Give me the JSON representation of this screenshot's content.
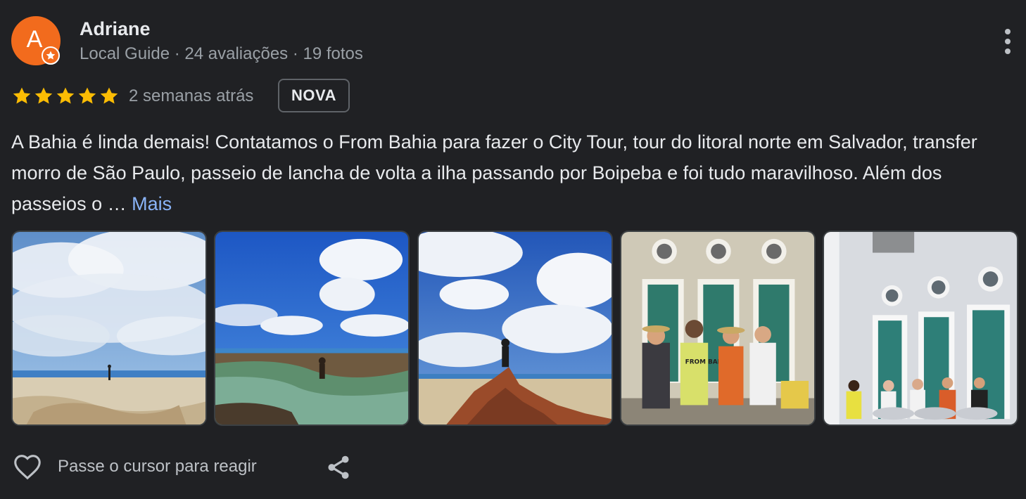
{
  "author": {
    "name": "Adriane",
    "initial": "A",
    "meta": "Local Guide · 24 avaliações · 19 fotos"
  },
  "rating": {
    "stars": 5,
    "time": "2 semanas atrás",
    "badge": "NOVA"
  },
  "review": {
    "text": "A Bahia é linda demais! Contatamos o From Bahia para fazer o City Tour, tour do litoral norte em Salvador, transfer morro de São Paulo, passeio de lancha de volta a ilha passando por Boipeba e foi tudo maravilhoso. Além dos passeios o … ",
    "more_label": "Mais"
  },
  "footer": {
    "react_label": "Passe o cursor para reagir"
  },
  "photos": {
    "count": 5,
    "photo4_shirt_text": "FROM BAHIA"
  },
  "colors": {
    "background": "#202124",
    "avatar": "#f26b1d",
    "star": "#fbbc04",
    "link": "#8ab4f8",
    "secondary_text": "#9aa0a6"
  },
  "icons": {
    "menu": "more-vertical-icon",
    "like": "heart-outline-icon",
    "share": "share-icon",
    "badge": "local-guide-star-icon"
  }
}
